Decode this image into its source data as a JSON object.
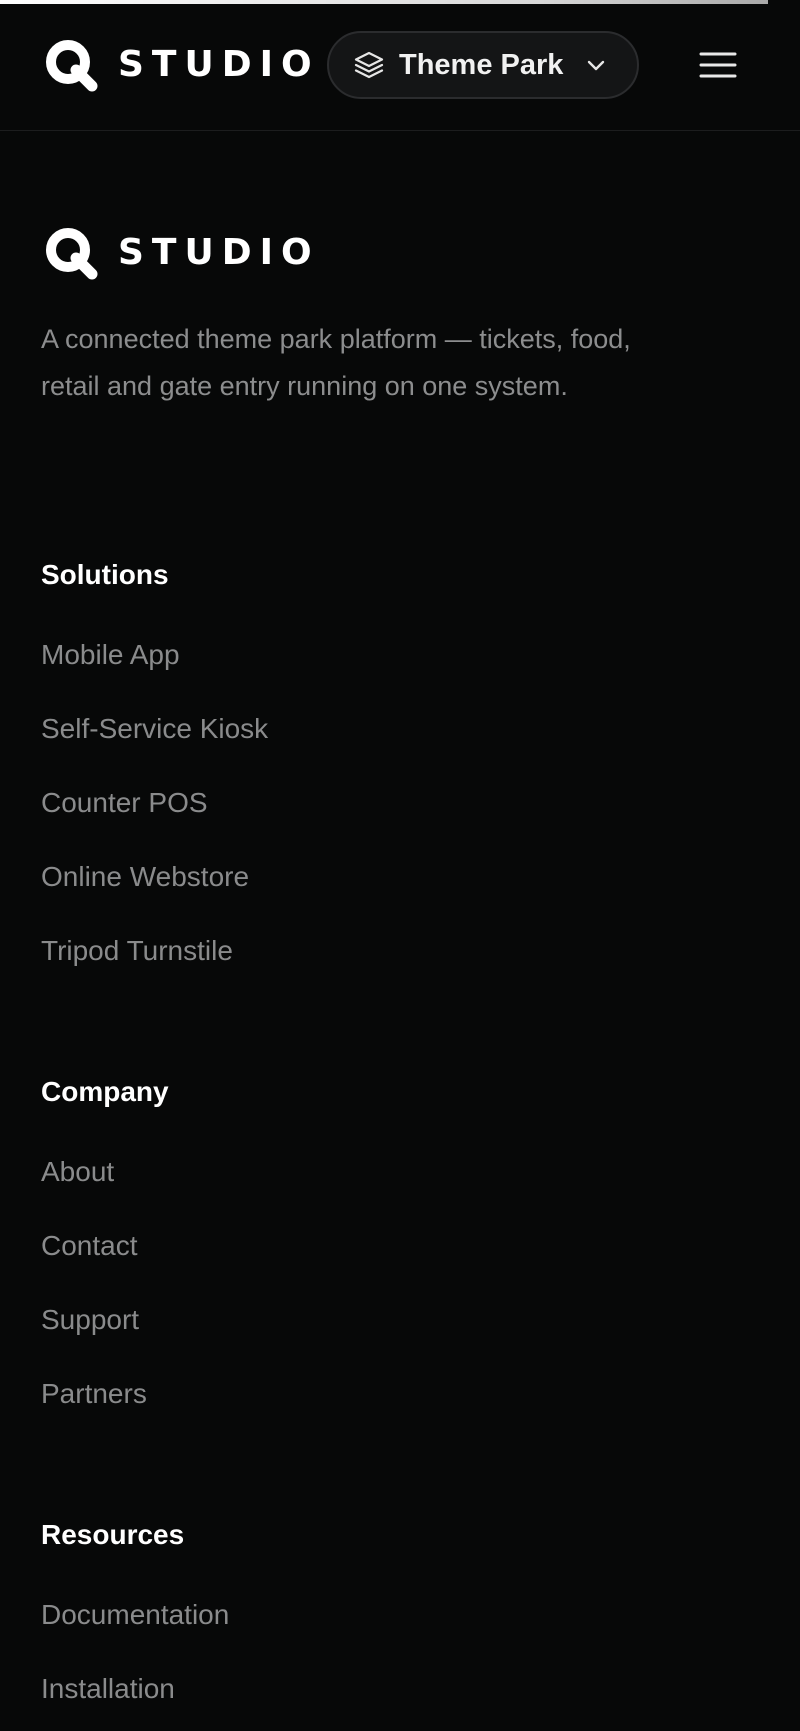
{
  "progress": 0.96,
  "brand": {
    "wordmark": "STUDIO",
    "logo_icon": "search-magnifier-logo-icon"
  },
  "header": {
    "switcher": {
      "icon": "layers-icon",
      "label": "Theme Park",
      "chevron_icon": "chevron-down-icon"
    },
    "menu_icon": "hamburger-menu-icon"
  },
  "footer": {
    "wordmark": "STUDIO",
    "tagline": "A connected theme park platform — tickets, food, retail and gate entry running on one system.",
    "columns": [
      {
        "heading": "Solutions",
        "links": [
          "Mobile App",
          "Self-Service Kiosk",
          "Counter POS",
          "Online Webstore",
          "Tripod Turnstile"
        ]
      },
      {
        "heading": "Company",
        "links": [
          "About",
          "Contact",
          "Support",
          "Partners"
        ]
      },
      {
        "heading": "Resources",
        "links": [
          "Documentation",
          "Installation"
        ]
      }
    ]
  },
  "colors": {
    "background": "#070808",
    "heading": "#ffffff",
    "link": "#8a8b8c",
    "pill_background": "#141516",
    "pill_border": "#2b2c2e"
  }
}
